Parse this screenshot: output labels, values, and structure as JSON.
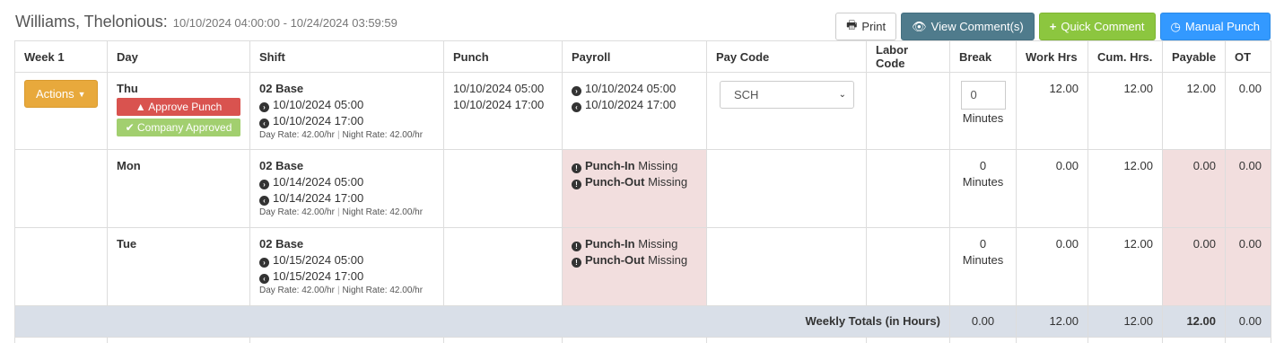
{
  "header": {
    "employee": "Williams, Thelonious:",
    "range": "10/10/2024 04:00:00 - 10/24/2024 03:59:59"
  },
  "toolbar": {
    "print": "Print",
    "view_comments": "View Comment(s)",
    "quick_comment": "Quick Comment",
    "manual_punch": "Manual Punch"
  },
  "columns": [
    "Week 1",
    "Day",
    "Shift",
    "Punch",
    "Payroll",
    "Pay Code",
    "Labor Code",
    "Break",
    "Work Hrs",
    "Cum. Hrs.",
    "Payable",
    "OT"
  ],
  "rows": [
    {
      "actions": "Actions",
      "day": "Thu",
      "approve": "Approve Punch",
      "approved": "Company Approved",
      "shift": "02 Base",
      "shift_in": "10/10/2024 05:00",
      "shift_out": "10/10/2024 17:00",
      "day_rate": "Day Rate: 42.00/hr",
      "night_rate": "Night Rate: 42.00/hr",
      "punch_in": "10/10/2024 05:00",
      "punch_out": "10/10/2024 17:00",
      "payroll_in": "10/10/2024 05:00",
      "payroll_out": "10/10/2024 17:00",
      "pay_code": "SCH",
      "break_value": "0",
      "break_unit": "Minutes",
      "work": "12.00",
      "cum": "12.00",
      "payable": "12.00",
      "ot": "0.00"
    },
    {
      "day": "Mon",
      "shift": "02 Base",
      "shift_in": "10/14/2024 05:00",
      "shift_out": "10/14/2024 17:00",
      "day_rate": "Day Rate: 42.00/hr",
      "night_rate": "Night Rate: 42.00/hr",
      "missing_in_label": "Punch-In",
      "missing_out_label": "Punch-Out",
      "missing": "Missing",
      "break_value": "0",
      "break_unit": "Minutes",
      "work": "0.00",
      "cum": "12.00",
      "payable": "0.00",
      "ot": "0.00"
    },
    {
      "day": "Tue",
      "shift": "02 Base",
      "shift_in": "10/15/2024 05:00",
      "shift_out": "10/15/2024 17:00",
      "day_rate": "Day Rate: 42.00/hr",
      "night_rate": "Night Rate: 42.00/hr",
      "missing_in_label": "Punch-In",
      "missing_out_label": "Punch-Out",
      "missing": "Missing",
      "break_value": "0",
      "break_unit": "Minutes",
      "work": "0.00",
      "cum": "12.00",
      "payable": "0.00",
      "ot": "0.00"
    }
  ],
  "totals": {
    "label": "Weekly Totals (in Hours)",
    "break": "0.00",
    "work": "12.00",
    "cum": "12.00",
    "payable": "12.00",
    "ot": "0.00"
  },
  "colors": {
    "warning": "#e8a93c",
    "danger": "#d9534f",
    "success": "#a2cf6f",
    "missing_bg": "#f2dede",
    "totals_bg": "#d9dfe8"
  },
  "icons": [
    "print-icon",
    "eye-icon",
    "plus-icon",
    "clock-icon",
    "caret-down-icon",
    "warning-icon",
    "check-icon",
    "arrow-right-circle-icon",
    "arrow-left-circle-icon",
    "exclamation-circle-icon"
  ]
}
